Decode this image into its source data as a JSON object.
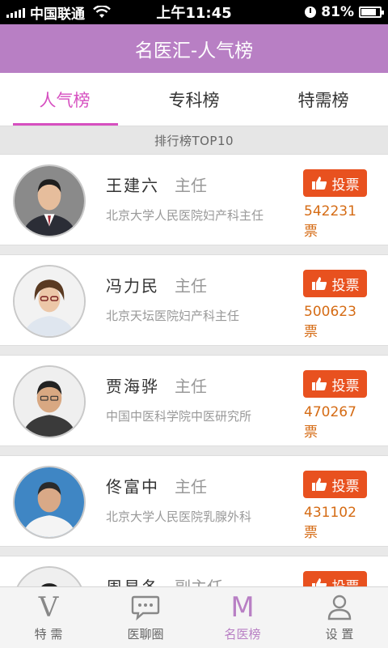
{
  "status_bar": {
    "carrier": "中国联通",
    "time": "上午11:45",
    "battery": "81%",
    "battery_level": 0.81
  },
  "header": {
    "title": "名医汇-人气榜"
  },
  "tabs": [
    {
      "label": "人气榜",
      "active": true
    },
    {
      "label": "专科榜",
      "active": false
    },
    {
      "label": "特需榜",
      "active": false
    }
  ],
  "rank_label": "排行榜TOP10",
  "vote_label": "投票",
  "doctors": [
    {
      "name": "王建六",
      "title": "主任",
      "hospital": "北京大学人民医院妇产科主任",
      "votes": "542231票"
    },
    {
      "name": "冯力民",
      "title": "主任",
      "hospital": "北京天坛医院妇产科主任",
      "votes": "500623票"
    },
    {
      "name": "贾海骅",
      "title": "主任",
      "hospital": "中国中医科学院中医研究所",
      "votes": "470267票"
    },
    {
      "name": "佟富中",
      "title": "主任",
      "hospital": "北京大学人民医院乳腺外科",
      "votes": "431102票"
    },
    {
      "name": "周易冬",
      "title": "副主任",
      "hospital": "",
      "votes": ""
    }
  ],
  "bottom_nav": [
    {
      "label": "特 需",
      "icon": "v-icon",
      "glyph": "V",
      "active": false
    },
    {
      "label": "医聊圈",
      "icon": "chat-bubble-icon",
      "active": false
    },
    {
      "label": "名医榜",
      "icon": "m-icon",
      "glyph": "M",
      "active": true
    },
    {
      "label": "设 置",
      "icon": "user-icon",
      "active": false
    }
  ],
  "colors": {
    "header_bg": "#b87fc4",
    "active_tab": "#d64fc0",
    "vote_button": "#e8511f",
    "vote_count": "#d56b14"
  }
}
